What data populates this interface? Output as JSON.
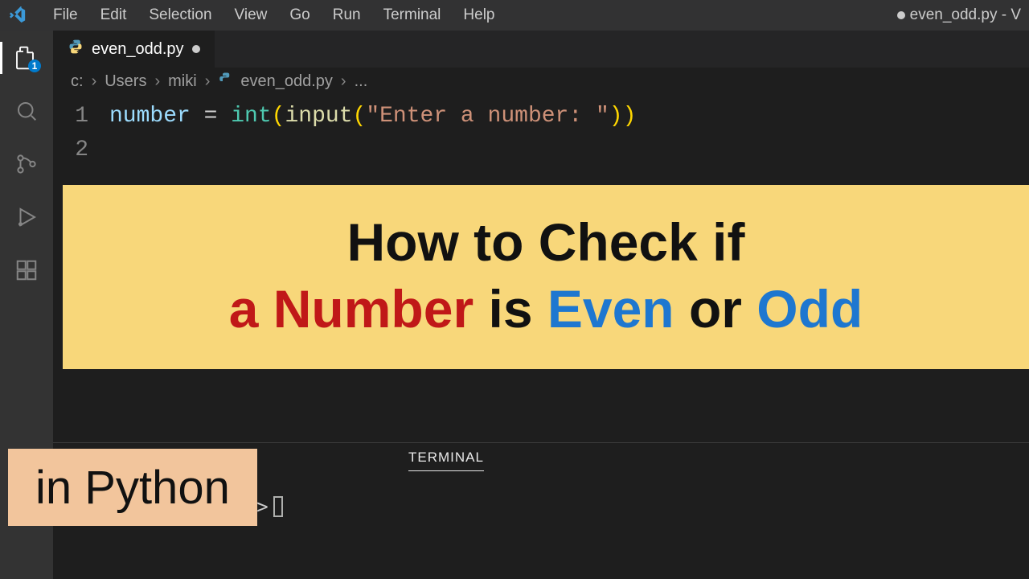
{
  "window": {
    "title": "even_odd.py - V",
    "unsaved": true
  },
  "menu": [
    "File",
    "Edit",
    "Selection",
    "View",
    "Go",
    "Run",
    "Terminal",
    "Help"
  ],
  "activity": {
    "explorer_badge": "1"
  },
  "tab": {
    "filename": "even_odd.py",
    "unsaved": true
  },
  "breadcrumb": {
    "parts": [
      "c:",
      "Users",
      "miki",
      "even_odd.py",
      "..."
    ]
  },
  "code": {
    "lines": [
      {
        "no": "1",
        "tokens": {
          "var": "number",
          "op": " = ",
          "fn1": "int",
          "p1": "(",
          "fn2": "input",
          "p2": "(",
          "str": "\"Enter a number: \"",
          "p3": ")",
          "p4": ")"
        }
      },
      {
        "no": "2",
        "text": ""
      }
    ]
  },
  "panel": {
    "tab": "TERMINAL",
    "prompt": "PS C:\\Users\\miki>"
  },
  "banner": {
    "line1_a": "How to Check if",
    "line2_red": "a Number",
    "line2_is": " is ",
    "line2_even": "Even",
    "line2_or": " or ",
    "line2_odd": "Odd",
    "sub": "in Python"
  }
}
